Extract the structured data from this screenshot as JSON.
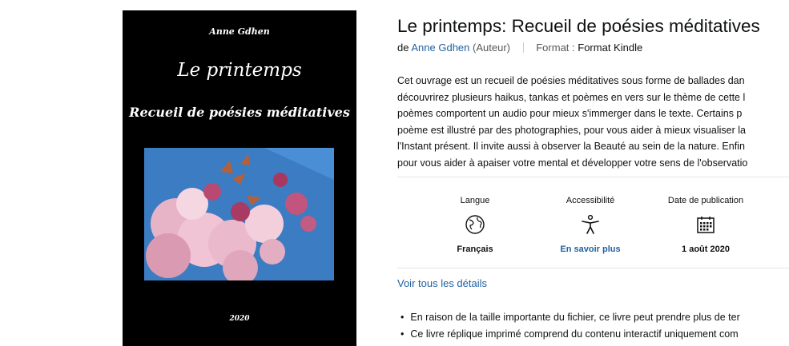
{
  "cover": {
    "author": "Anne Gdhen",
    "title_line1": "Le printemps",
    "title_line2": "Recueil de poésies méditatives",
    "year": "2020"
  },
  "product": {
    "title": "Le printemps: Recueil de poésies méditatives",
    "by_prefix": "de",
    "author": "Anne Gdhen",
    "role": "(Auteur)",
    "format_label": "Format :",
    "format_value": "Format Kindle"
  },
  "description": [
    "Cet ouvrage est un recueil de poésies méditatives sous forme de ballades dan",
    "découvrirez plusieurs haikus, tankas et poèmes en vers sur le thème de cette l",
    "poèmes comportent un audio pour mieux s'immerger dans le texte. Certains p",
    "poème est illustré par des photographies, pour vous aider à mieux visualiser la",
    "l'Instant présent. Il invite aussi à observer la Beauté au sein de la nature. Enfin",
    "pour vous aider à apaiser votre mental et développer votre sens de l'observatio"
  ],
  "attributes": [
    {
      "label": "Langue",
      "icon": "globe-icon",
      "value": "Français",
      "link": false
    },
    {
      "label": "Accessibilité",
      "icon": "accessibility-icon",
      "value": "En savoir plus",
      "link": true
    },
    {
      "label": "Date de publication",
      "icon": "calendar-icon",
      "value": "1 août 2020",
      "link": false
    }
  ],
  "details_link": "Voir tous les détails",
  "bullets": [
    "En raison de la taille importante du fichier, ce livre peut prendre plus de ter",
    "Ce livre réplique imprimé comprend du contenu interactif uniquement com"
  ],
  "colors": {
    "link": "#2162a1",
    "text": "#0f1111",
    "muted": "#565959"
  }
}
